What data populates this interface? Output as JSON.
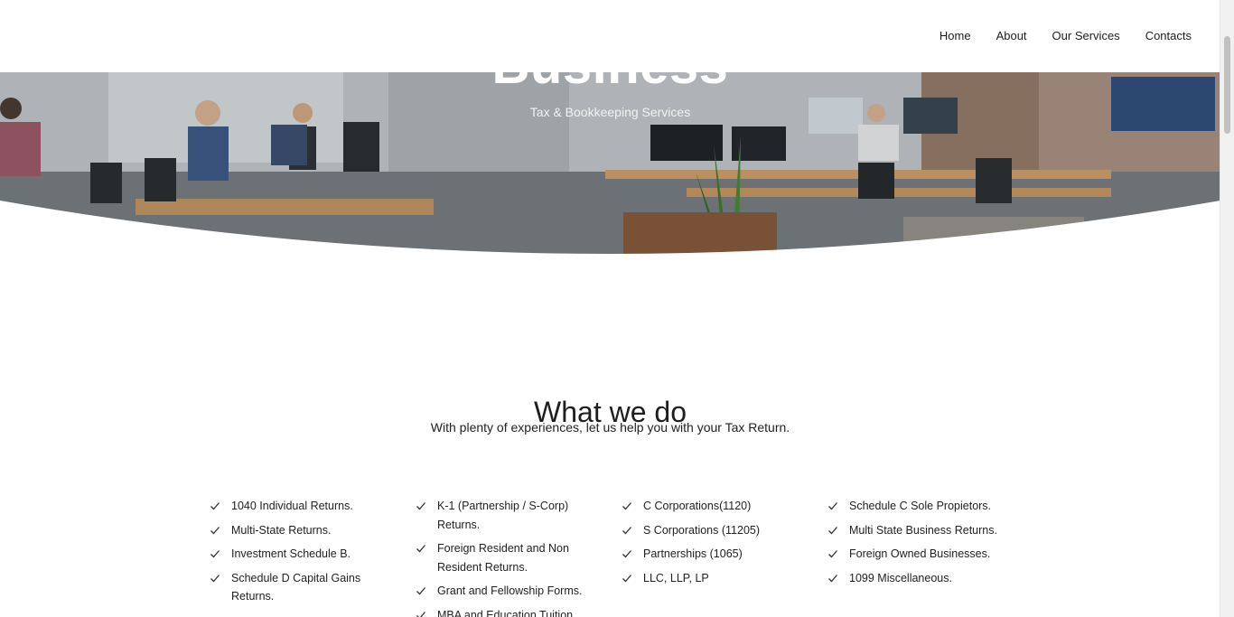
{
  "nav": {
    "items": [
      "Home",
      "About",
      "Our Services",
      "Contacts"
    ]
  },
  "hero": {
    "title": "Business",
    "subtitle": "Tax & Bookkeeping Services"
  },
  "section": {
    "title": "What we do",
    "subtitle": "With plenty of experiences, let us help you with your Tax Return."
  },
  "columns": [
    {
      "items": [
        "1040 Individual Returns.",
        "Multi-State Returns.",
        "Investment Schedule B.",
        "Schedule D Capital Gains Returns."
      ]
    },
    {
      "items": [
        "K-1 (Partnership / S-Corp) Returns.",
        "Foreign Resident and Non Resident Returns.",
        "Grant and Fellowship Forms.",
        "MBA and Education Tuition"
      ]
    },
    {
      "items": [
        "C Corporations(1120)",
        "S Corporations (11205)",
        "Partnerships (1065)",
        "LLC, LLP, LP"
      ]
    },
    {
      "items": [
        "Schedule C Sole Propietors.",
        "Multi State Business Returns.",
        "Foreign Owned Businesses.",
        "1099 Miscellaneous."
      ]
    }
  ],
  "icons": {
    "list_marker": "check-icon"
  },
  "colors": {
    "text": "#222222",
    "background": "#ffffff",
    "hero_text": "#ffffff"
  }
}
